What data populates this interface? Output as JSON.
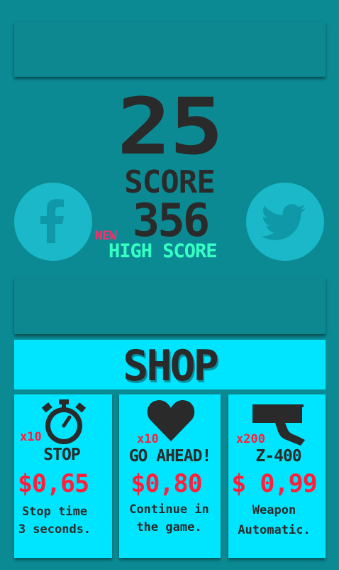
{
  "game_over": {
    "score": "25",
    "score_label": "SCORE",
    "high_score": "356",
    "new_label": "NEW",
    "high_score_label": "HIGH SCORE"
  },
  "social": {
    "facebook_icon": "facebook-icon",
    "twitter_icon": "twitter-icon"
  },
  "shop": {
    "title": "SHOP",
    "items": [
      {
        "icon": "stopwatch-icon",
        "quantity": "x10",
        "name": "STOP",
        "price": "$0,65",
        "desc_line1": "Stop time",
        "desc_line2": "3 seconds."
      },
      {
        "icon": "heart-icon",
        "quantity": "x10",
        "name": "GO AHEAD!",
        "price": "$0,80",
        "desc_line1": "Continue in",
        "desc_line2": "the game."
      },
      {
        "icon": "gun-icon",
        "quantity": "x200",
        "name": "Z-400",
        "price": "$ 0,99",
        "desc_line1": "Weapon",
        "desc_line2": "Automatic."
      }
    ]
  },
  "colors": {
    "background": "#0b8a93",
    "shop_cyan": "#00e5ff",
    "price_red": "#ff1e3c",
    "new_pink": "#ff2d6b",
    "highscore_green": "#36ffc4"
  }
}
